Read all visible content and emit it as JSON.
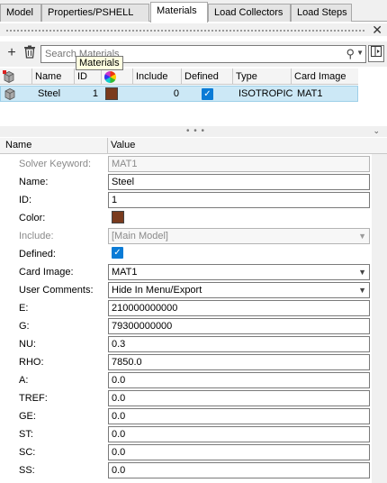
{
  "tabs": [
    {
      "label": "Model",
      "active": false
    },
    {
      "label": "Properties/PSHELL",
      "active": false
    },
    {
      "label": "Materials",
      "active": true
    },
    {
      "label": "Load Collectors",
      "active": false
    },
    {
      "label": "Load Steps",
      "active": false
    }
  ],
  "toolbar": {
    "add_label": "+",
    "search_placeholder": "Search Materials",
    "tooltip": "Materials"
  },
  "grid": {
    "columns": [
      "Name",
      "ID",
      "",
      "Include",
      "Defined",
      "Type",
      "Card Image"
    ],
    "rows": [
      {
        "name": "Steel",
        "id": "1",
        "color": "#7a3b1e",
        "include": "0",
        "defined": true,
        "type": "ISOTROPIC",
        "card_image": "MAT1"
      }
    ]
  },
  "props": {
    "headers": {
      "name": "Name",
      "value": "Value"
    },
    "rows": [
      {
        "label": "Solver Keyword:",
        "value": "MAT1",
        "kind": "text",
        "disabled": true
      },
      {
        "label": "Name:",
        "value": "Steel",
        "kind": "text"
      },
      {
        "label": "ID:",
        "value": "1",
        "kind": "text"
      },
      {
        "label": "Color:",
        "value": "#7a3b1e",
        "kind": "color"
      },
      {
        "label": "Include:",
        "value": "[Main Model]",
        "kind": "select",
        "disabled": true
      },
      {
        "label": "Defined:",
        "value": "checked",
        "kind": "check"
      },
      {
        "label": "Card Image:",
        "value": "MAT1",
        "kind": "select"
      },
      {
        "label": "User Comments:",
        "value": "Hide In Menu/Export",
        "kind": "select"
      },
      {
        "label": "E:",
        "value": "210000000000",
        "kind": "text"
      },
      {
        "label": "G:",
        "value": "79300000000",
        "kind": "text"
      },
      {
        "label": "NU:",
        "value": "0.3",
        "kind": "text"
      },
      {
        "label": "RHO:",
        "value": "7850.0",
        "kind": "text"
      },
      {
        "label": "A:",
        "value": "0.0",
        "kind": "text"
      },
      {
        "label": "TREF:",
        "value": "0.0",
        "kind": "text"
      },
      {
        "label": "GE:",
        "value": "0.0",
        "kind": "text"
      },
      {
        "label": "ST:",
        "value": "0.0",
        "kind": "text"
      },
      {
        "label": "SC:",
        "value": "0.0",
        "kind": "text"
      },
      {
        "label": "SS:",
        "value": "0.0",
        "kind": "text"
      }
    ]
  }
}
